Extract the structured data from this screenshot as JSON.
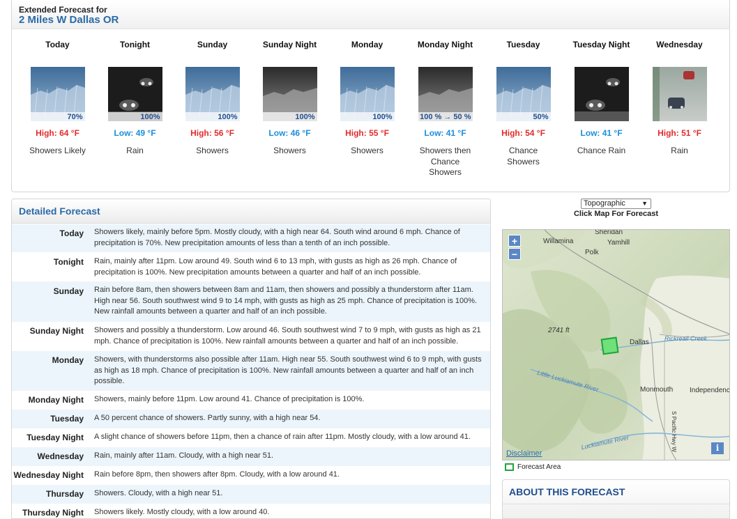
{
  "header": {
    "label": "Extended Forecast for",
    "location": "2 Miles W Dallas OR"
  },
  "periods": [
    {
      "name": "Today",
      "pct": "70%",
      "temp": "High: 64 °F",
      "kind": "hi",
      "short": "Showers Likely",
      "icon": "showers-icon"
    },
    {
      "name": "Tonight",
      "pct": "100%",
      "temp": "Low: 49 °F",
      "kind": "lo",
      "short": "Rain",
      "icon": "night-rain-icon"
    },
    {
      "name": "Sunday",
      "pct": "100%",
      "temp": "High: 56 °F",
      "kind": "hi",
      "short": "Showers",
      "icon": "showers-icon"
    },
    {
      "name": "Sunday Night",
      "pct": "100%",
      "temp": "Low: 46 °F",
      "kind": "lo",
      "short": "Showers",
      "icon": "night-showers-icon"
    },
    {
      "name": "Monday",
      "pct": "100%",
      "temp": "High: 55 °F",
      "kind": "hi",
      "short": "Showers",
      "icon": "showers-icon"
    },
    {
      "name": "Monday Night",
      "pct": "100 % → 50 %",
      "temp": "Low: 41 °F",
      "kind": "lo",
      "short": "Showers then Chance Showers",
      "icon": "night-showers-icon"
    },
    {
      "name": "Tuesday",
      "pct": "50%",
      "temp": "High: 54 °F",
      "kind": "hi",
      "short": "Chance Showers",
      "icon": "showers-icon"
    },
    {
      "name": "Tuesday Night",
      "pct": "",
      "temp": "Low: 41 °F",
      "kind": "lo",
      "short": "Chance Rain",
      "icon": "night-rain-icon"
    },
    {
      "name": "Wednesday",
      "pct": "",
      "temp": "High: 51 °F",
      "kind": "hi",
      "short": "Rain",
      "icon": "day-rain-icon"
    }
  ],
  "detailed": {
    "title": "Detailed Forecast",
    "rows": [
      {
        "label": "Today",
        "text": "Showers likely, mainly before 5pm. Mostly cloudy, with a high near 64. South wind around 6 mph. Chance of precipitation is 70%. New precipitation amounts of less than a tenth of an inch possible."
      },
      {
        "label": "Tonight",
        "text": "Rain, mainly after 11pm. Low around 49. South wind 6 to 13 mph, with gusts as high as 26 mph. Chance of precipitation is 100%. New precipitation amounts between a quarter and half of an inch possible."
      },
      {
        "label": "Sunday",
        "text": "Rain before 8am, then showers between 8am and 11am, then showers and possibly a thunderstorm after 11am. High near 56. South southwest wind 9 to 14 mph, with gusts as high as 25 mph. Chance of precipitation is 100%. New rainfall amounts between a quarter and half of an inch possible."
      },
      {
        "label": "Sunday Night",
        "text": "Showers and possibly a thunderstorm. Low around 46. South southwest wind 7 to 9 mph, with gusts as high as 21 mph. Chance of precipitation is 100%. New rainfall amounts between a quarter and half of an inch possible."
      },
      {
        "label": "Monday",
        "text": "Showers, with thunderstorms also possible after 11am. High near 55. South southwest wind 6 to 9 mph, with gusts as high as 18 mph. Chance of precipitation is 100%. New rainfall amounts between a quarter and half of an inch possible."
      },
      {
        "label": "Monday Night",
        "text": "Showers, mainly before 11pm. Low around 41. Chance of precipitation is 100%."
      },
      {
        "label": "Tuesday",
        "text": "A 50 percent chance of showers. Partly sunny, with a high near 54."
      },
      {
        "label": "Tuesday Night",
        "text": "A slight chance of showers before 11pm, then a chance of rain after 11pm. Mostly cloudy, with a low around 41."
      },
      {
        "label": "Wednesday",
        "text": "Rain, mainly after 11am. Cloudy, with a high near 51."
      },
      {
        "label": "Wednesday Night",
        "text": "Rain before 8pm, then showers after 8pm. Cloudy, with a low around 41."
      },
      {
        "label": "Thursday",
        "text": "Showers. Cloudy, with a high near 51."
      },
      {
        "label": "Thursday Night",
        "text": "Showers likely. Mostly cloudy, with a low around 40."
      }
    ]
  },
  "map": {
    "select_value": "Topographic",
    "click_label": "Click Map For Forecast",
    "zoom_in": "+",
    "zoom_out": "−",
    "places": {
      "sheridan": "Sheridan",
      "willamina": "Willamina",
      "yamhill": "Yamhill",
      "polk": "Polk",
      "elevation": "2741 ft",
      "dallas": "Dallas",
      "rickreall": "Rickreall Creek",
      "luckiamute": "Little Luckiamute River",
      "luckiamute2": "Luckiamute River",
      "monmouth": "Monmouth",
      "independence": "Independence",
      "pacific": "S Pacific Hwy W"
    },
    "disclaimer": "Disclaimer",
    "info": "i",
    "legend": "Forecast Area"
  },
  "about": {
    "title": "ABOUT THIS FORECAST"
  },
  "colors": {
    "accent": "#2b6aa8",
    "high": "#e32b2b",
    "low": "#1b8edc",
    "forecast_area": "#1ea43a"
  }
}
